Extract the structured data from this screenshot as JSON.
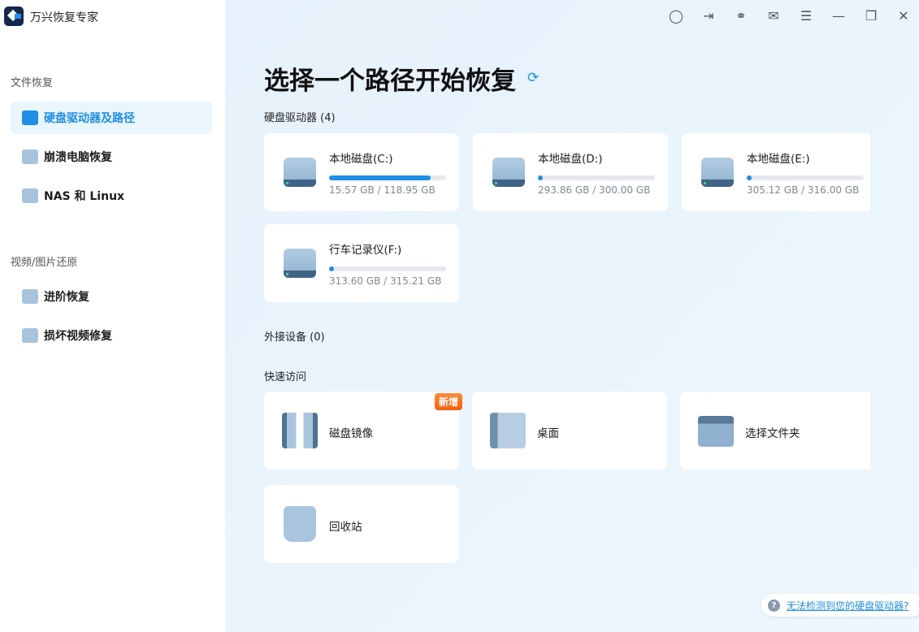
{
  "app": {
    "title": "万兴恢复专家"
  },
  "sidebar": {
    "sections": [
      {
        "title": "文件恢复",
        "items": [
          {
            "label": "硬盘驱动器及路径",
            "icon": "hard-drive-icon",
            "active": true
          },
          {
            "label": "崩溃电脑恢复",
            "icon": "monitor-icon"
          },
          {
            "label": "NAS 和 Linux",
            "icon": "server-icon"
          }
        ]
      },
      {
        "title": "视频/图片还原",
        "items": [
          {
            "label": "进阶恢复",
            "icon": "camera-icon"
          },
          {
            "label": "损坏视频修复",
            "icon": "video-repair-icon"
          }
        ]
      }
    ]
  },
  "toolbar": [
    "user-icon",
    "login-icon",
    "support-icon",
    "mail-icon",
    "menu-icon",
    "minimize-icon",
    "restore-icon",
    "close-icon"
  ],
  "main": {
    "title": "选择一个路径开始恢复",
    "drives_label": "硬盘驱动器",
    "drives_count": "(4)",
    "drives": [
      {
        "name": "本地磁盘(C:)",
        "size": "15.57 GB / 118.95 GB",
        "used_pct": 87,
        "windows": true
      },
      {
        "name": "本地磁盘(D:)",
        "size": "293.86 GB / 300.00 GB",
        "used_pct": 2
      },
      {
        "name": "本地磁盘(E:)",
        "size": "305.12 GB / 316.00 GB",
        "used_pct": 3
      },
      {
        "name": "行车记录仪(F:)",
        "size": "313.60 GB / 315.21 GB",
        "used_pct": 1
      }
    ],
    "external_label": "外接设备",
    "external_count": "(0)",
    "quick_label": "快速访问",
    "quick": [
      {
        "name": "磁盘镜像",
        "badge": "新增"
      },
      {
        "name": "桌面"
      },
      {
        "name": "选择文件夹"
      },
      {
        "name": "回收站"
      }
    ],
    "help_link": "无法检测到您的硬盘驱动器?"
  },
  "colors": {
    "accent": "#1e8ee6",
    "badge": "#f4600f"
  }
}
